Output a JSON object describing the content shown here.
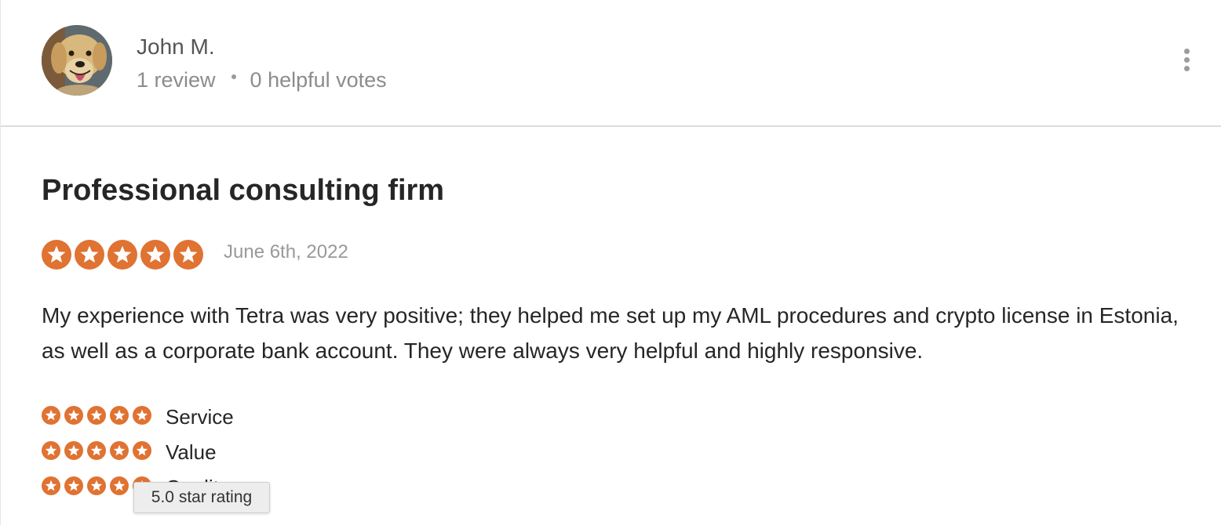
{
  "reviewer": {
    "name": "John M.",
    "review_count": "1 review",
    "helpful_votes": "0 helpful votes"
  },
  "review": {
    "title": "Professional consulting firm",
    "rating": 5,
    "date": "June 6th, 2022",
    "body": "My experience with Tetra was very positive; they helped me set up my AML procedures and crypto license in Estonia, as well as a corporate bank account. They were always very helpful and highly responsive.",
    "sub_ratings": [
      {
        "label": "Service",
        "rating": 5
      },
      {
        "label": "Value",
        "rating": 5
      },
      {
        "label": "Quality",
        "rating": 5
      }
    ]
  },
  "tooltip": {
    "text": "5.0 star rating"
  },
  "colors": {
    "star": "#e07232",
    "meta": "#8c8c8c"
  },
  "icons": {
    "menu": "more-vertical-icon",
    "star": "star-icon",
    "avatar": "dog-photo"
  }
}
